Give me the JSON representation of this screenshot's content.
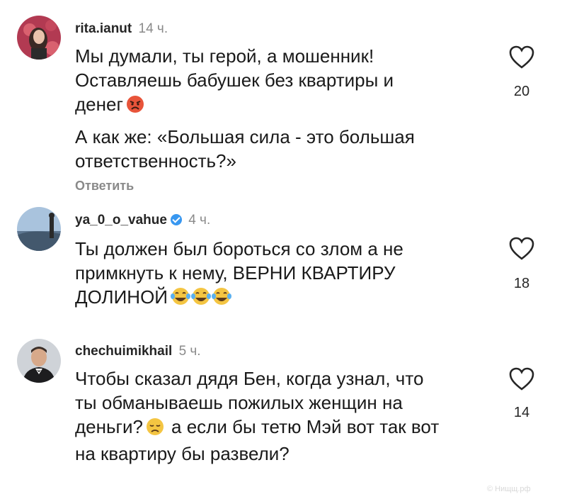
{
  "comments": [
    {
      "username": "rita.ianut",
      "time": "14 ч.",
      "verified": false,
      "text_lines": [
        "Мы думали, ты герой, а мошенник!",
        "Оставляешь бабушек без квартиры и",
        "денег"
      ],
      "text2_lines": [
        "А как же: «Большая сила - это большая",
        "ответственность?»"
      ],
      "reply_label": "Ответить",
      "likes": "20",
      "emoji": "angry-face"
    },
    {
      "username": "ya_0_o_vahue",
      "time": "4 ч.",
      "verified": true,
      "text_lines": [
        "Ты должен был бороться со злом а не",
        "примкнуть к нему, ВЕРНИ КВАРТИРУ",
        "ДОЛИНОЙ"
      ],
      "likes": "18",
      "emoji": "crying-laughing-face x3"
    },
    {
      "username": "chechuimikhail",
      "time": "5 ч.",
      "verified": false,
      "text_lines": [
        "Чтобы сказал дядя Бен, когда узнал, что",
        "ты обманываешь пожилых женщин на",
        "деньги?",
        "а если бы тетю Мэй вот так вот",
        "на квартиру бы развели?"
      ],
      "likes": "14",
      "emoji": "disappointed-face"
    }
  ],
  "watermark": "© Нищщ.рф",
  "colors": {
    "meta": "#8a8a8a",
    "text": "#1a1a1a",
    "verified": "#3897f0",
    "emoji": "#f4c542",
    "angry": "#e8543a"
  }
}
